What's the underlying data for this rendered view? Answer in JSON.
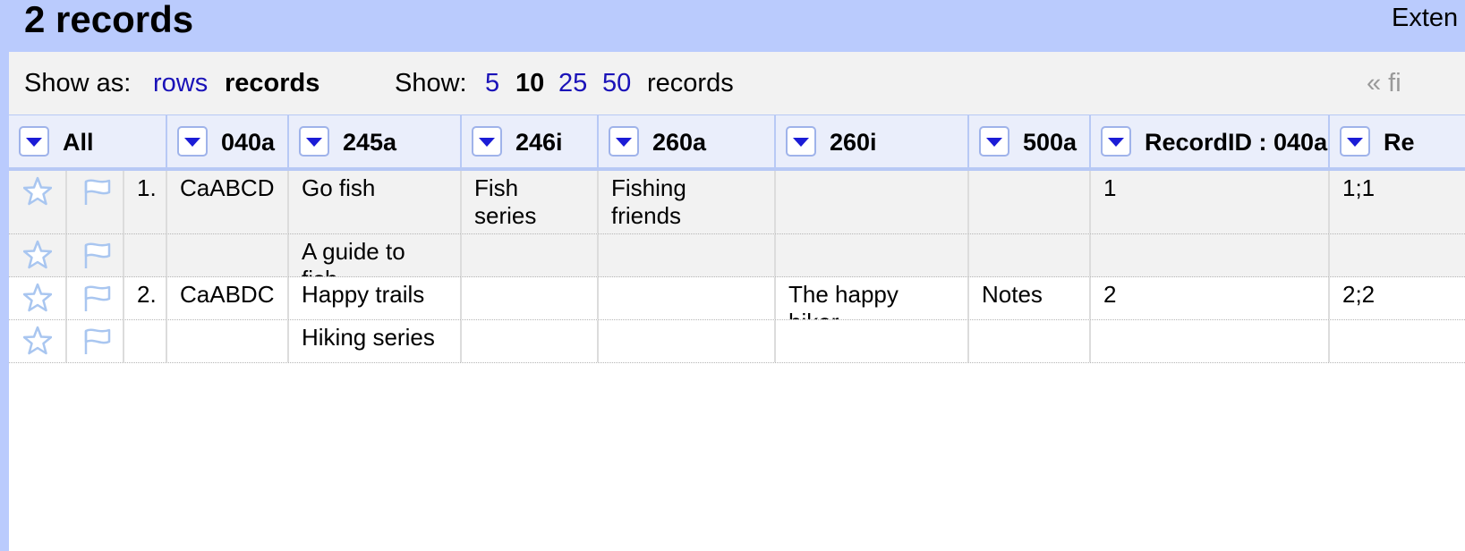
{
  "header": {
    "record_count": "2 records",
    "extensions": "Exten"
  },
  "toolbar": {
    "show_as_label": "Show as:",
    "rows_label": "rows",
    "records_label": "records",
    "show_label": "Show:",
    "page_sizes": [
      "5",
      "10",
      "25",
      "50"
    ],
    "selected_page_size": "10",
    "records_suffix": "records",
    "first_link": "« fi"
  },
  "columns": [
    {
      "label": "All"
    },
    {
      "label": "040a"
    },
    {
      "label": "245a"
    },
    {
      "label": "246i"
    },
    {
      "label": "260a"
    },
    {
      "label": "260i"
    },
    {
      "label": "500a"
    },
    {
      "label": "RecordID : 040a"
    },
    {
      "label": "Re"
    }
  ],
  "rows": [
    {
      "num": "1.",
      "c040a": "CaABCD",
      "c245a": "Go fish",
      "c246i": "Fish series",
      "c260a": "Fishing friends",
      "c260i": "",
      "c500a": "",
      "recordid": "1",
      "re": "1;1"
    },
    {
      "num": "",
      "c040a": "",
      "c245a": "A guide to fish",
      "c246i": "",
      "c260a": "",
      "c260i": "",
      "c500a": "",
      "recordid": "",
      "re": ""
    },
    {
      "num": "2.",
      "c040a": "CaABDC",
      "c245a": "Happy trails",
      "c246i": "",
      "c260a": "",
      "c260i": "The happy hiker",
      "c500a": "Notes",
      "recordid": "2",
      "re": "2;2"
    },
    {
      "num": "",
      "c040a": "",
      "c245a": "Hiking series",
      "c246i": "",
      "c260a": "",
      "c260i": "",
      "c500a": "",
      "recordid": "",
      "re": ""
    }
  ],
  "icons": {
    "star": "star-icon",
    "flag": "flag-icon",
    "dropdown": "dropdown-arrow-icon"
  },
  "colors": {
    "title_bar": "#bacbfd",
    "link": "#1a12b8",
    "header_row": "#eaeefb",
    "odd_row": "#f2f2f2",
    "icon_outline": "#a9c6f0"
  }
}
